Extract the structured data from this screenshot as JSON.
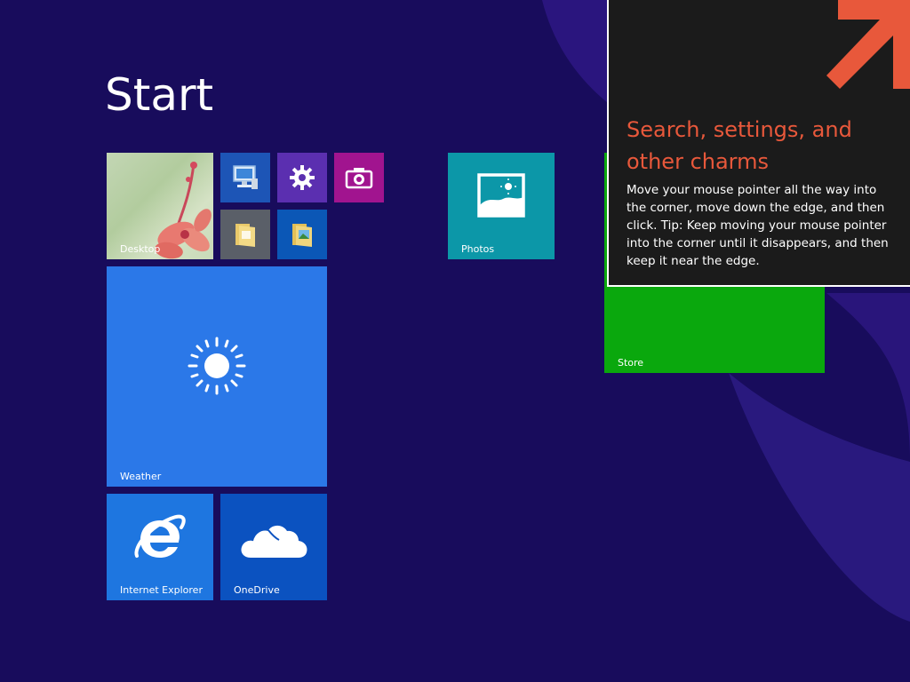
{
  "screen": {
    "title": "Start"
  },
  "tiles": {
    "desktop": {
      "label": "Desktop"
    },
    "photos": {
      "label": "Photos"
    },
    "weather": {
      "label": "Weather"
    },
    "internet_explorer": {
      "label": "Internet Explorer"
    },
    "onedrive": {
      "label": "OneDrive"
    },
    "store": {
      "label": "Store"
    },
    "small_icons": [
      "computer-icon",
      "gear-icon",
      "camera-icon",
      "folder-icon",
      "pictures-folder-icon"
    ]
  },
  "tip": {
    "title": "Search, settings, and other charms",
    "body": "Move your mouse pointer all the way into the corner, move down the edge, and then click. Tip: Keep moving your mouse pointer into the corner until it disappears, and then keep it near the edge."
  },
  "colors": {
    "background": "#180c5c",
    "accent_orange": "#e8583b",
    "store_green": "#0aa80d",
    "weather_blue": "#2b78e8",
    "photos_teal": "#0c97a8"
  }
}
